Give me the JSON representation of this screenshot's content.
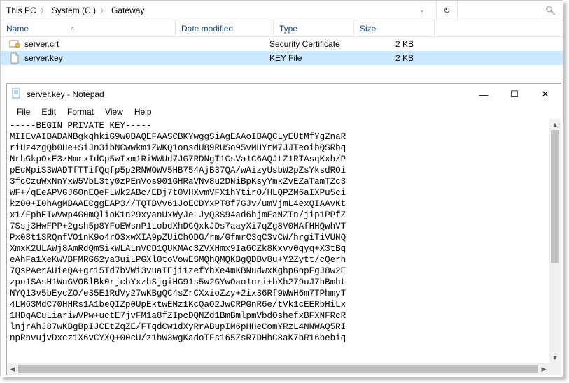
{
  "breadcrumb": {
    "items": [
      "This PC",
      "System (C:)",
      "Gateway"
    ]
  },
  "columns": {
    "name": "Name",
    "date": "Date modified",
    "type": "Type",
    "size": "Size"
  },
  "files": [
    {
      "name": "server.crt",
      "date": "",
      "type": "Security Certificate",
      "size": "2 KB",
      "icon": "cert"
    },
    {
      "name": "server.key",
      "date": "",
      "type": "KEY File",
      "size": "2 KB",
      "icon": "file",
      "selected": true
    }
  ],
  "notepad": {
    "title": "server.key - Notepad",
    "menu": [
      "File",
      "Edit",
      "Format",
      "View",
      "Help"
    ],
    "content": "-----BEGIN PRIVATE KEY-----\nMIIEvAIBADANBgkqhkiG9w0BAQEFAASCBKYwggSiAgEAAoIBAQCLyEUtMfYgZnaR\nriUz4zgQb0He+SiJn3ibNCwwkm1ZWKQ1onsdU89RUSo95vMHYrM7JJTeoibQSRbq\nNrhGkpOxE3zMmrxIdCp5wIxm1RiWWUd7JG7RDNgT1CsVa1C6AQJtZ1RTAsqKxh/P\npEcMpiS3WADTfTTifQqfp5p2RNWOWV5HB754AjB37QA/wAizyUsbW2pZsYksdROi\n3fcCzuWxNnYxW5VbL3ty0zPEnVos901GHRaVNv8u2DNiBpKsyYmkZvEZaTamTZc3\nWF+/qEeAPVGJ6OnEQeFLWk2ABc/EDj7t0VHXvmVFX1hYtirO/HLQPZM6aIXPu5ci\nkz00+I0hAgMBAAECggEAP3//TQTBVv61JoECDYxPT8f7GJv/umVjmL4exQIAAvKt\nx1/FphEIwVwp4G0mQlioK1n29xyanUxWyJeLJyQ3S94ad6hjmFaNZTn/jip1PPfZ\n7Ssj3HwFPP+2gsh5p8YFoEWsnP1LobdXhDCQxkJDs7aayXi7qZg8V0MAfHHQwhVT\nPx08t1SRQnfVO1nK9o4rO3xwXIA9pZUiChODG/rm/GfmrC3qC3vCW/hrgiTiVUNQ\nXmxK2ULAWj8AmRdQmSikWLALnVCD1QUKMAc3ZVXHmx9Ia6CZk8Kxvv0qyq+X3tBq\neAhFa1XeKwVBFMRG62ya3uiLPGXl0toVowESMQhQMQKBgQDBv8u+Y2Zytt/cQerh\n7QsPAerAUieQA+gr15Td7bVWi3vuaIEji1zefYhXe4mKBNudwxKghpGnpFgJ8w2E\nzpo1SAsH1WnGVOBlBk0rjcbYxzhSjgiHG91s5w2GYwOao1nri+bXh279uJ7hBmht\nNYQ13v5bEycZO/e35E1RdVy27wKBgQC4sZrCXxioZzy+2ix36Rf9WWH6m7TPhmyT\n4LM63MdC70HHRs1A1beQIZp0UpEktwEMz1KcQaO2JwCRPGnR6e/tVk1cEERbHiLx\n1HDqACuLiariwVPw+uctE7jvFM1a8fZIpcDQNZd1BmBmlpmVbdOshefxBFXNFRcR\nlnjrAhJ87wKBgBpIJCEtZqZE/FTqdCw1dXyRrABupIM6pHHeComYRzL4NNWAQ5RI\nnpRnvujvDxcz1X6vCYXQ+00cU/z1hW3wgKadoTFs165ZsR7DHhC8aK7bR16bebiq"
  }
}
